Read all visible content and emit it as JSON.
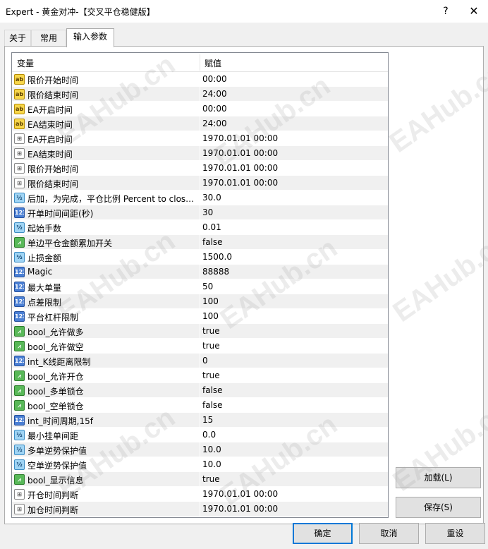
{
  "window": {
    "title": "Expert - 黄金对冲-【交叉平仓稳健版】",
    "help_label": "?",
    "close_label": "✕"
  },
  "tabs": [
    {
      "label": "关于",
      "active": false
    },
    {
      "label": "常用",
      "active": false
    },
    {
      "label": "输入参数",
      "active": true
    }
  ],
  "grid": {
    "col_variable": "变量",
    "col_value": "赋值",
    "rows": [
      {
        "type": "ab",
        "name": "限价开始时间",
        "value": "00:00"
      },
      {
        "type": "ab",
        "name": "限价结束时间",
        "value": "24:00"
      },
      {
        "type": "ab",
        "name": "EA开启时间",
        "value": "00:00"
      },
      {
        "type": "ab",
        "name": "EA结束时间",
        "value": "24:00"
      },
      {
        "type": "dt",
        "name": "EA开启时间",
        "value": "1970.01.01 00:00"
      },
      {
        "type": "dt",
        "name": "EA结束时间",
        "value": "1970.01.01 00:00"
      },
      {
        "type": "dt",
        "name": "限价开始时间",
        "value": "1970.01.01 00:00"
      },
      {
        "type": "dt",
        "name": "限价结束时间",
        "value": "1970.01.01 00:00"
      },
      {
        "type": "dbl",
        "name": "后加，为完成，平仓比例 Percent to close...",
        "value": "30.0"
      },
      {
        "type": "int",
        "name": "开单时间间距(秒)",
        "value": "30"
      },
      {
        "type": "dbl",
        "name": "起始手数",
        "value": "0.01"
      },
      {
        "type": "bool",
        "name": "单边平仓金额累加开关",
        "value": "false"
      },
      {
        "type": "dbl",
        "name": "止损金额",
        "value": "1500.0"
      },
      {
        "type": "int",
        "name": "Magic",
        "value": "88888"
      },
      {
        "type": "int",
        "name": "最大单量",
        "value": "50"
      },
      {
        "type": "int",
        "name": "点差限制",
        "value": "100"
      },
      {
        "type": "int",
        "name": "平台杠杆限制",
        "value": "100"
      },
      {
        "type": "bool",
        "name": "bool_允许做多",
        "value": "true"
      },
      {
        "type": "bool",
        "name": "bool_允许做空",
        "value": "true"
      },
      {
        "type": "int",
        "name": "int_K线距离限制",
        "value": "0"
      },
      {
        "type": "bool",
        "name": "bool_允许开仓",
        "value": "true"
      },
      {
        "type": "bool",
        "name": "bool_多单锁仓",
        "value": "false"
      },
      {
        "type": "bool",
        "name": "bool_空单锁仓",
        "value": "false"
      },
      {
        "type": "int",
        "name": "int_时间周期,15f",
        "value": "15"
      },
      {
        "type": "dbl",
        "name": "最小挂单间距",
        "value": "0.0"
      },
      {
        "type": "dbl",
        "name": "多单逆势保护值",
        "value": "10.0"
      },
      {
        "type": "dbl",
        "name": "空单逆势保护值",
        "value": "10.0"
      },
      {
        "type": "bool",
        "name": "bool_显示信息",
        "value": "true"
      },
      {
        "type": "dt",
        "name": "开仓时间判断",
        "value": "1970.01.01 00:00"
      },
      {
        "type": "dt",
        "name": "加仓时间判断",
        "value": "1970.01.01 00:00"
      }
    ]
  },
  "icons": {
    "ab": "ab",
    "dt": "⊞",
    "dbl": "½",
    "int": "123",
    "bool": "⩘"
  },
  "buttons": {
    "load": "加载(L)",
    "save": "保存(S)",
    "ok": "确定",
    "cancel": "取消",
    "reset": "重设"
  },
  "watermark": "EAHub.cn"
}
